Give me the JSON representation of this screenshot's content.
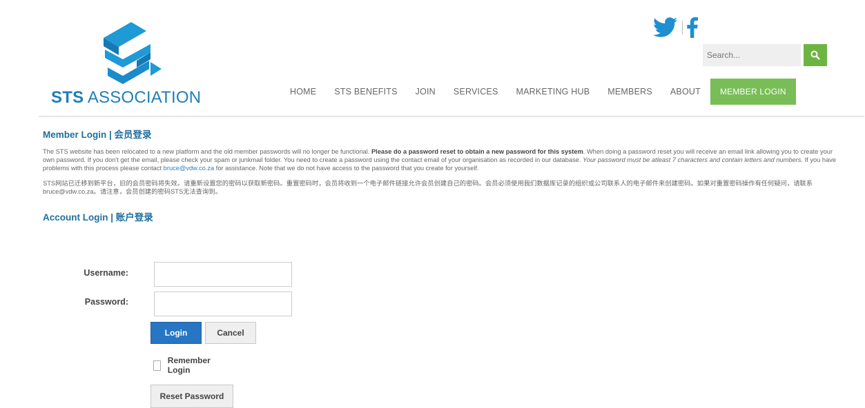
{
  "brand": {
    "bold": "STS",
    "rest": " ASSOCIATION",
    "accent": "#1f7fb8",
    "icon": "sts-s-arrow-logo"
  },
  "social": {
    "twitter_icon": "twitter-icon",
    "facebook_icon": "facebook-icon"
  },
  "search": {
    "placeholder": "Search...",
    "icon": "search-icon",
    "button_color": "#6db543"
  },
  "nav": {
    "items": [
      "HOME",
      "STS BENEFITS",
      "JOIN",
      "SERVICES",
      "MARKETING HUB",
      "MEMBERS",
      "ABOUT"
    ],
    "login": "MEMBER LOGIN",
    "login_color": "#79bd57"
  },
  "member_login": {
    "title": "Member Login | 会员登录",
    "p1_a": "The STS website has been relocated to a new platform and the old member passwords will no longer be functional. ",
    "p1_b": "Please do a password reset to obtain a new password for this system",
    "p1_c": ". When doing a password reset you will receive an email link allowing you to create your own password. If you don't get the email, please check your spam or junkmail folder.  You need to create a password using the contact email of your organisation as recorded in our database. ",
    "p1_d": "Your password must be atleast 7 characters and contain letters and numbers.",
    "p1_e": " If you have problems with this process please contact ",
    "p1_link": "bruce@vdw.co.za",
    "p1_f": " for assistance. Note that we do not have access to the password that you create for yourself.",
    "p2": "STS网站已迁移到新平台，旧的会员密码将失效。请重新设置您的密码以获取新密码。重置密码时，会员将收到一个电子邮件链接允许会员创建自己的密码。会员必须使用我们数据库记录的组织或公司联系人的电子邮件来创建密码。如果对重置密码操作有任何疑问，请联系bruce@vdw.co.za。请注意，会员创建的密码STS无法查询到。"
  },
  "account_login": {
    "title": "Account Login | 账户登录",
    "username_label": "Username:",
    "username_value": "",
    "password_label": "Password:",
    "password_value": "",
    "login_button": "Login",
    "cancel_button": "Cancel",
    "remember_label": "Remember Login",
    "remember_checked": false,
    "reset_button": "Reset Password",
    "login_color": "#2776c4"
  }
}
